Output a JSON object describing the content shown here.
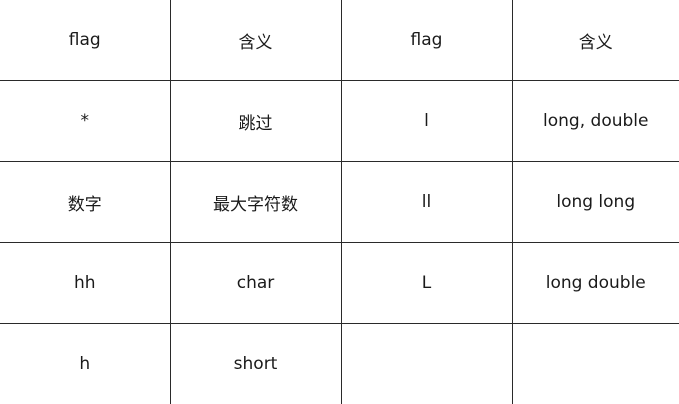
{
  "table": {
    "headers": [
      "flag",
      "含义",
      "flag",
      "含义"
    ],
    "rows": [
      [
        "*",
        "跳过",
        "l",
        "long, double"
      ],
      [
        "数字",
        "最大字符数",
        "ll",
        "long long"
      ],
      [
        "hh",
        "char",
        "L",
        "long double"
      ],
      [
        "h",
        "short",
        "",
        ""
      ]
    ]
  }
}
